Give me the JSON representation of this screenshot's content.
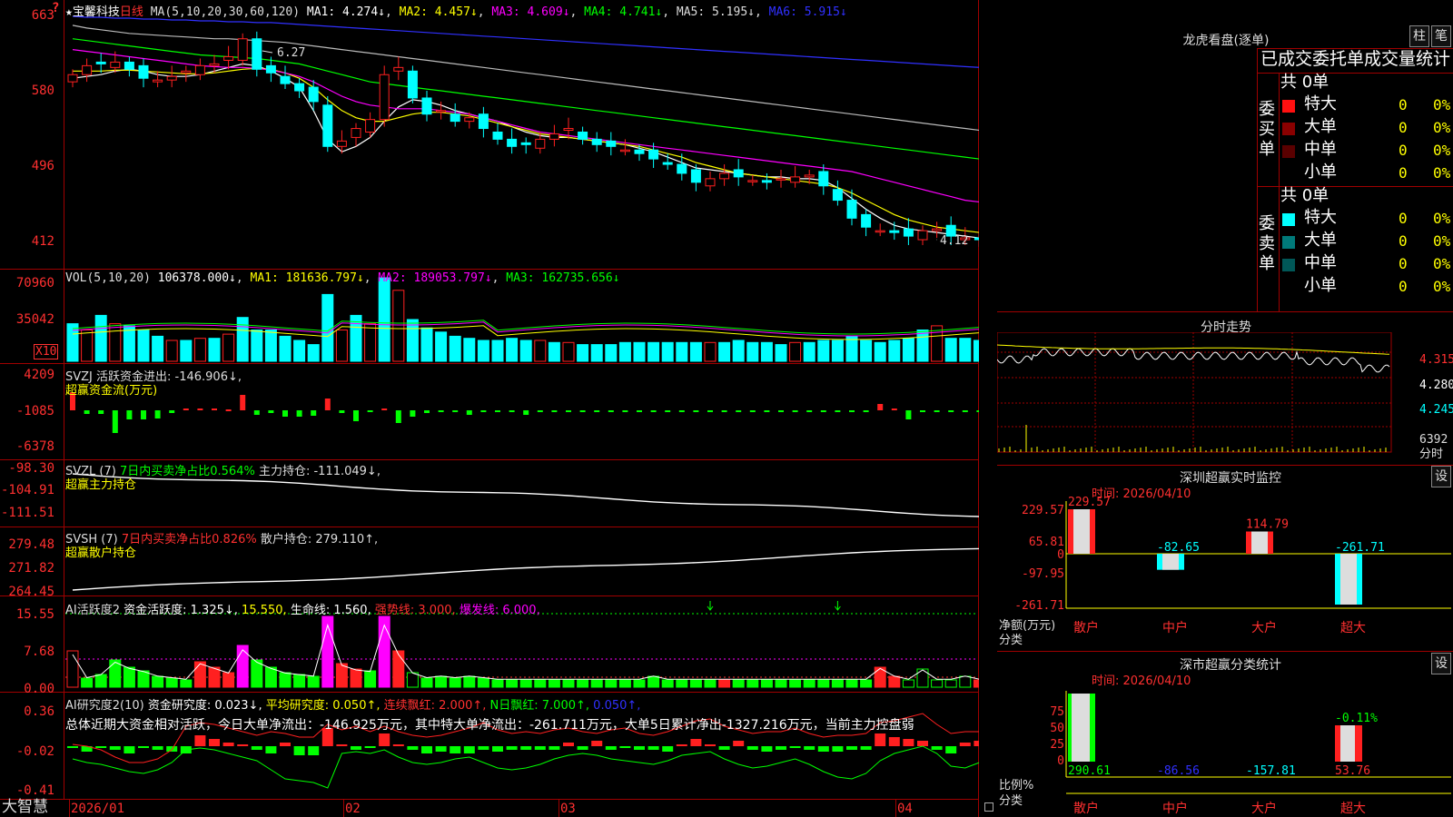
{
  "colors": {
    "up": "#ff2020",
    "down": "#00ffff",
    "red_axis": "#ff3030",
    "border": "#a00000"
  },
  "main": {
    "star": "★",
    "stock_name": "宝馨科技",
    "period": "日线",
    "ma_params": "MA(5,10,20,30,60,120)",
    "ma1": "MA1: 4.274↓",
    "ma2": "MA2: 4.457↓",
    "ma3": "MA3: 4.609↓",
    "ma4": "MA4: 4.741↓",
    "ma5": "MA5: 5.195↓",
    "ma6": "MA6: 5.915↓",
    "y_ticks": [
      "663",
      "580",
      "496",
      "412"
    ],
    "high_label": "6.27",
    "low_label": "4.12",
    "question": "?"
  },
  "vol": {
    "header": "VOL(5,10,20)",
    "value": "106378.000↓",
    "ma1": "MA1: 181636.797↓",
    "ma2": "MA2: 189053.797↓",
    "ma3": "MA3: 162735.656↓",
    "y_ticks": [
      "70960",
      "35042"
    ],
    "unit": "X10"
  },
  "svzj": {
    "header": "SVZJ  活跃资金进出: -146.906↓,",
    "sub": "超赢资金流(万元)",
    "y_ticks": [
      "4209",
      "-1085",
      "-6378"
    ]
  },
  "svzl": {
    "name": "SVZL (7)",
    "ratio": "7日内买卖净占比0.564%",
    "hold": "主力持仓: -111.049↓,",
    "sub": "超赢主力持仓",
    "y_ticks": [
      "-98.30",
      "-104.91",
      "-111.51"
    ]
  },
  "svsh": {
    "name": "SVSH (7)",
    "ratio": "7日内买卖净占比0.826%",
    "hold": "散户持仓: 279.110↑,",
    "sub": "超赢散户持仓",
    "y_ticks": [
      "279.48",
      "271.82",
      "264.45"
    ]
  },
  "ai1": {
    "name": "AI活跃度2",
    "active": "资金活跃度: 1.325↓,",
    "v2": "15.550,",
    "life": "生命线: 1.560,",
    "strong": "强势线: 3.000,",
    "burst": "爆发线: 6.000,",
    "y_ticks": [
      "15.55",
      "7.68",
      "0.00"
    ]
  },
  "ai2": {
    "name": "AI研究度2(10)",
    "research": "资金研究度: 0.023↓,",
    "avg": "平均研究度: 0.050↑,",
    "red": "连续飘红: 2.000↑,",
    "nred": "N日飘红: 7.000↑,",
    "v5": "0.050↑,",
    "summary": "总体近期大资金相对活跃，今日大单净流出：-146.925万元，其中特大单净流出：-261.711万元，大单5日累计净出-1327.216万元，当前主力控盘弱",
    "y_ticks": [
      "0.36",
      "-0.02",
      "-0.41"
    ]
  },
  "xaxis": {
    "labels": [
      "2026/01",
      "02",
      "03",
      "04"
    ],
    "logo": "大智慧"
  },
  "longhu": {
    "title": "龙虎看盘(逐单)",
    "btn_bar": "柱",
    "btn_stroke": "笔",
    "stat_title": "已成交委托单成交量统计",
    "buy_label": "委买单",
    "sell_label": "委卖单",
    "total": "共 0单",
    "rows": [
      {
        "name": "特大",
        "count": "0",
        "pct": "0%"
      },
      {
        "name": "大单",
        "count": "0",
        "pct": "0%"
      },
      {
        "name": "中单",
        "count": "0",
        "pct": "0%"
      },
      {
        "name": "小单",
        "count": "0",
        "pct": "0%"
      }
    ]
  },
  "intraday": {
    "title": "分时走势",
    "y_ticks": [
      "4.315",
      "4.280",
      "4.245"
    ],
    "vol_tick": "6392",
    "vol_unit": "分时"
  },
  "monitor": {
    "title": "深圳超赢实时监控",
    "btn": "设",
    "time": "时间: 2026/04/10",
    "y_ticks": [
      "229.57",
      "65.81",
      "0",
      "-97.95",
      "-261.71"
    ],
    "ylabel": "净额(万元)",
    "xlabel": "分类",
    "categories": [
      "散户",
      "中户",
      "大户",
      "超大"
    ],
    "values": [
      229.57,
      -82.65,
      114.79,
      -261.71
    ],
    "value_labels": [
      "229.57",
      "-82.65",
      "114.79",
      "-261.71"
    ]
  },
  "classify": {
    "title": "深市超赢分类统计",
    "btn": "设",
    "time": "时间: 2026/04/10",
    "y_ticks": [
      "75",
      "50",
      "25",
      "0"
    ],
    "ylabel": "比例%",
    "xlabel": "分类",
    "categories": [
      "散户",
      "中户",
      "大户",
      "超大"
    ],
    "bottom_values": [
      "290.61",
      "-86.56",
      "-157.81",
      "53.76"
    ],
    "top_value": "-0.11%"
  }
}
